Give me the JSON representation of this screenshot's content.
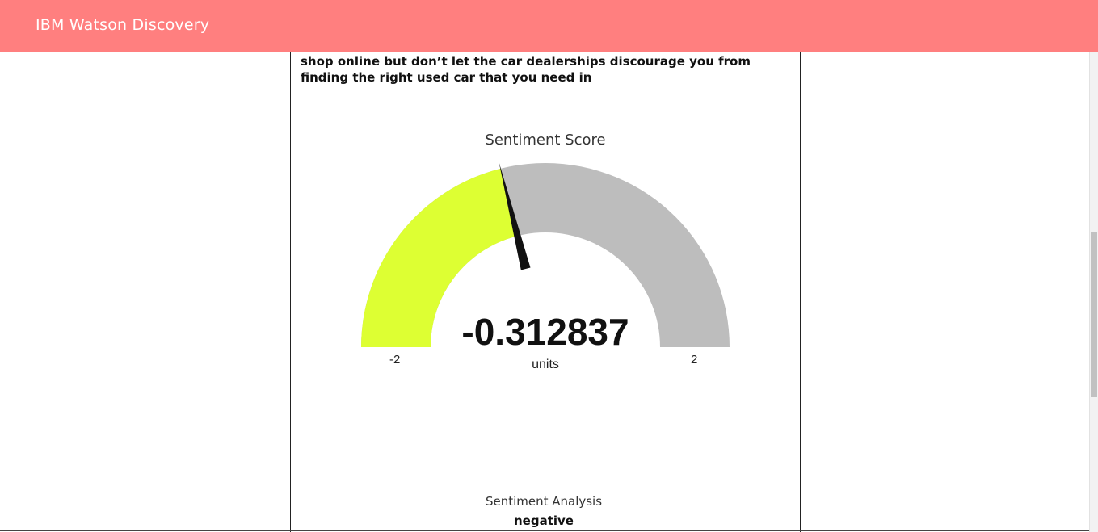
{
  "app": {
    "title": "IBM Watson Discovery"
  },
  "article": {
    "text": "shop online but don’t let the car dealerships discourage you from finding the right used car that you need in"
  },
  "gauge": {
    "title": "Sentiment Score",
    "value": "-0.312837",
    "score": -0.312837,
    "min": -2,
    "max": 2,
    "min_label": "-2",
    "max_label": "2",
    "units": "units",
    "fill_color": "#ddff33",
    "track_color": "#bdbdbd",
    "needle_color": "#111111"
  },
  "analysis": {
    "label": "Sentiment Analysis",
    "value": "negative"
  },
  "colors": {
    "header": "#ff7f7f"
  }
}
